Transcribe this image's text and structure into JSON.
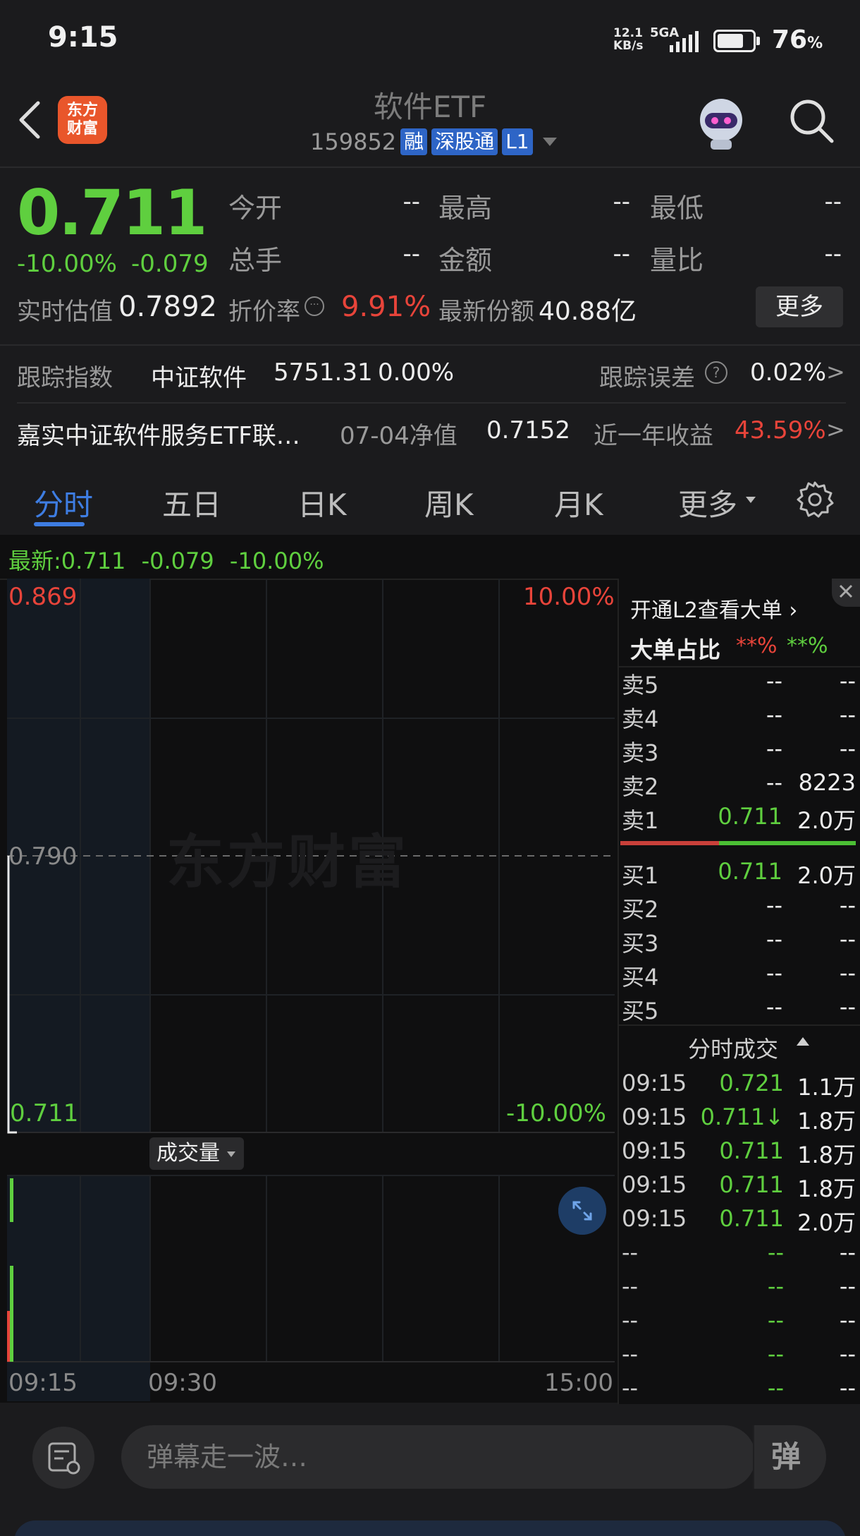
{
  "status_bar": {
    "time": "9:15",
    "speed_top": "12.1",
    "speed_bottom": "KB/s",
    "network": "5GA",
    "battery_pct": "76",
    "battery_unit": "%",
    "battery_level": 0.76
  },
  "header": {
    "title": "软件ETF",
    "code": "159852",
    "tags": [
      "融",
      "深股通",
      "L1"
    ],
    "logo_line1": "东方",
    "logo_line2": "财富"
  },
  "quote": {
    "price": "0.711",
    "change_pct": "-10.00%",
    "change": "-0.079",
    "stats": [
      {
        "label": "今开",
        "value": "--"
      },
      {
        "label": "最高",
        "value": "--"
      },
      {
        "label": "最低",
        "value": "--"
      },
      {
        "label": "总手",
        "value": "--"
      },
      {
        "label": "金额",
        "value": "--"
      },
      {
        "label": "量比",
        "value": "--"
      }
    ],
    "est_label": "实时估值",
    "est_value": "0.7892",
    "discount_label": "折价率",
    "discount_value": "9.91%",
    "shares_label": "最新份额",
    "shares_value": "40.88亿",
    "more_label": "更多"
  },
  "tracking": {
    "label": "跟踪指数",
    "index_name": "中证软件",
    "index_value": "5751.31",
    "index_pct": "0.00%",
    "error_label": "跟踪误差",
    "error_value": "0.02%",
    "fund_name": "嘉实中证软件服务ETF联…",
    "nav_label": "07-04净值",
    "nav_value": "0.7152",
    "year_label": "近一年收益",
    "year_value": "43.59%"
  },
  "tabs": [
    "分时",
    "五日",
    "日K",
    "周K",
    "月K",
    "更多"
  ],
  "chart": {
    "latest_label": "最新:",
    "latest_price": "0.711",
    "latest_change": "-0.079",
    "latest_pct": "-10.00%",
    "max": "0.869",
    "max_pct": "10.00%",
    "mid": "0.790",
    "min": "0.711",
    "min_pct": "-10.00%",
    "watermark": "东方财富",
    "volume_label": "成交量",
    "times": [
      "09:15",
      "09:30",
      "15:00"
    ]
  },
  "order_book": {
    "l2_link": "开通L2查看大单",
    "big_order_label": "大单占比",
    "big_order_red": "**%",
    "big_order_green": "**%",
    "sells": [
      {
        "label": "卖5",
        "price": "--",
        "vol": "--"
      },
      {
        "label": "卖4",
        "price": "--",
        "vol": "--"
      },
      {
        "label": "卖3",
        "price": "--",
        "vol": "--"
      },
      {
        "label": "卖2",
        "price": "--",
        "vol": "8223"
      },
      {
        "label": "卖1",
        "price": "0.711",
        "vol": "2.0万"
      }
    ],
    "buys": [
      {
        "label": "买1",
        "price": "0.711",
        "vol": "2.0万"
      },
      {
        "label": "买2",
        "price": "--",
        "vol": "--"
      },
      {
        "label": "买3",
        "price": "--",
        "vol": "--"
      },
      {
        "label": "买4",
        "price": "--",
        "vol": "--"
      },
      {
        "label": "买5",
        "price": "--",
        "vol": "--"
      }
    ],
    "trades_title": "分时成交",
    "trades": [
      {
        "time": "09:15",
        "price": "0.721",
        "vol": "1.1万"
      },
      {
        "time": "09:15",
        "price": "0.711↓",
        "vol": "1.8万"
      },
      {
        "time": "09:15",
        "price": "0.711",
        "vol": "1.8万"
      },
      {
        "time": "09:15",
        "price": "0.711",
        "vol": "1.8万"
      },
      {
        "time": "09:15",
        "price": "0.711",
        "vol": "2.0万"
      },
      {
        "time": "--",
        "price": "--",
        "vol": "--"
      },
      {
        "time": "--",
        "price": "--",
        "vol": "--"
      },
      {
        "time": "--",
        "price": "--",
        "vol": "--"
      },
      {
        "time": "--",
        "price": "--",
        "vol": "--"
      },
      {
        "time": "--",
        "price": "--",
        "vol": "--"
      }
    ]
  },
  "bottom": {
    "placeholder": "弹幕走一波…",
    "danmu_label": "弹"
  },
  "colors": {
    "up": "#e8443a",
    "down": "#5fcf3f",
    "accent": "#3e7de2"
  }
}
